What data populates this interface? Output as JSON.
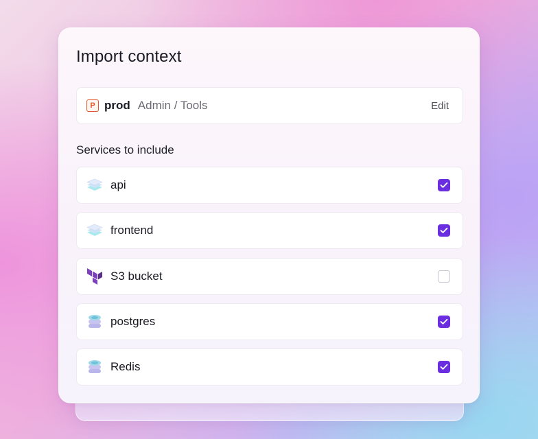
{
  "dialog": {
    "title": "Import context"
  },
  "context": {
    "badge_letter": "P",
    "name": "prod",
    "path": "Admin / Tools",
    "edit_label": "Edit"
  },
  "services": {
    "label": "Services to include",
    "items": [
      {
        "name": "api",
        "icon": "stack-layers-icon",
        "checked": true
      },
      {
        "name": "frontend",
        "icon": "stack-layers-icon",
        "checked": true
      },
      {
        "name": "S3 bucket",
        "icon": "terraform-icon",
        "checked": false
      },
      {
        "name": "postgres",
        "icon": "database-icon",
        "checked": true
      },
      {
        "name": "Redis",
        "icon": "database-icon",
        "checked": true
      }
    ]
  },
  "colors": {
    "accent": "#6a2ee0",
    "badge": "#e2552d",
    "terraform": "#7b42bc"
  }
}
